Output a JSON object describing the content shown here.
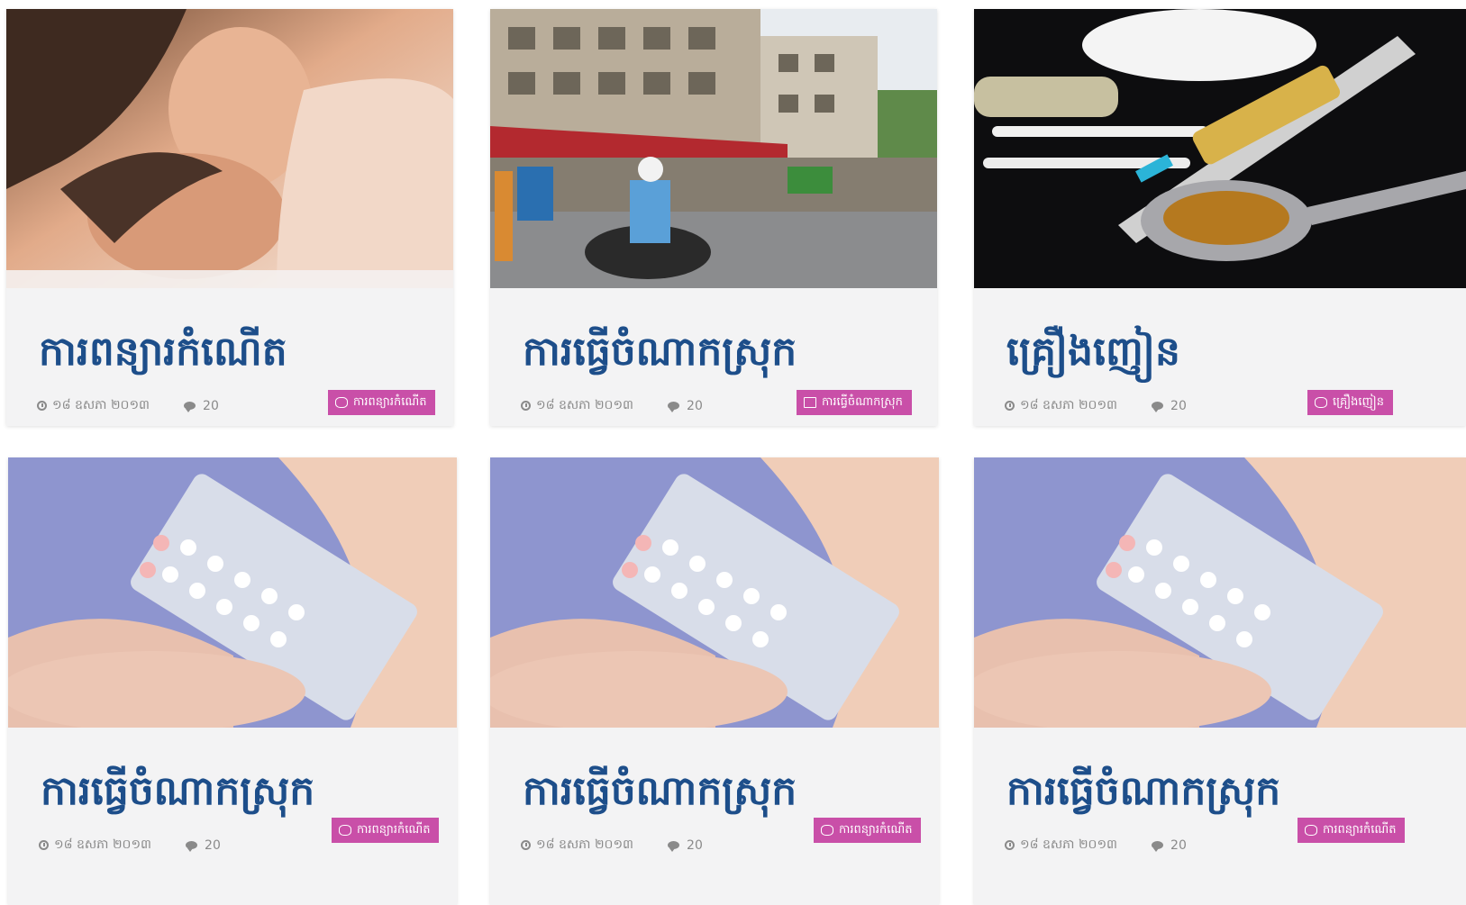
{
  "cards": [
    {
      "title": "ការពន្យារកំណើត",
      "date": "១៨ ឧសភា ២០១៣",
      "comments": "20",
      "category": "ការពន្យារកំណើត",
      "image_alt": "couple photo",
      "category_icon": "circle-flower-icon"
    },
    {
      "title": "ការធ្វើចំណាកស្រុក",
      "date": "១៨ ឧសភា ២០១៣",
      "comments": "20",
      "category": "ការធ្វើចំណាកស្រុក",
      "image_alt": "street photo",
      "category_icon": "book-icon"
    },
    {
      "title": "គ្រឿងញៀន",
      "date": "១៨ ឧសភា ២០១៣",
      "comments": "20",
      "category": "គ្រឿងញៀន",
      "image_alt": "drugs photo",
      "category_icon": "syringe-icon"
    },
    {
      "title": "ការធ្វើចំណាកស្រុក",
      "date": "១៨ ឧសភា ២០១៣",
      "comments": "20",
      "category": "ការពន្យារកំណើត",
      "image_alt": "pills photo",
      "category_icon": "circle-flower-icon"
    },
    {
      "title": "ការធ្វើចំណាកស្រុក",
      "date": "១៨ ឧសភា ២០១៣",
      "comments": "20",
      "category": "ការពន្យារកំណើត",
      "image_alt": "pills photo",
      "category_icon": "circle-flower-icon"
    },
    {
      "title": "ការធ្វើចំណាកស្រុក",
      "date": "១៨ ឧសភា ២០១៣",
      "comments": "20",
      "category": "ការពន្យារកំណើត",
      "image_alt": "pills photo",
      "category_icon": "circle-flower-icon"
    }
  ],
  "colors": {
    "title": "#1d4e8a",
    "badge": "#c94fa8",
    "meta": "#8a8a8a",
    "card_bg": "#f3f3f4"
  }
}
